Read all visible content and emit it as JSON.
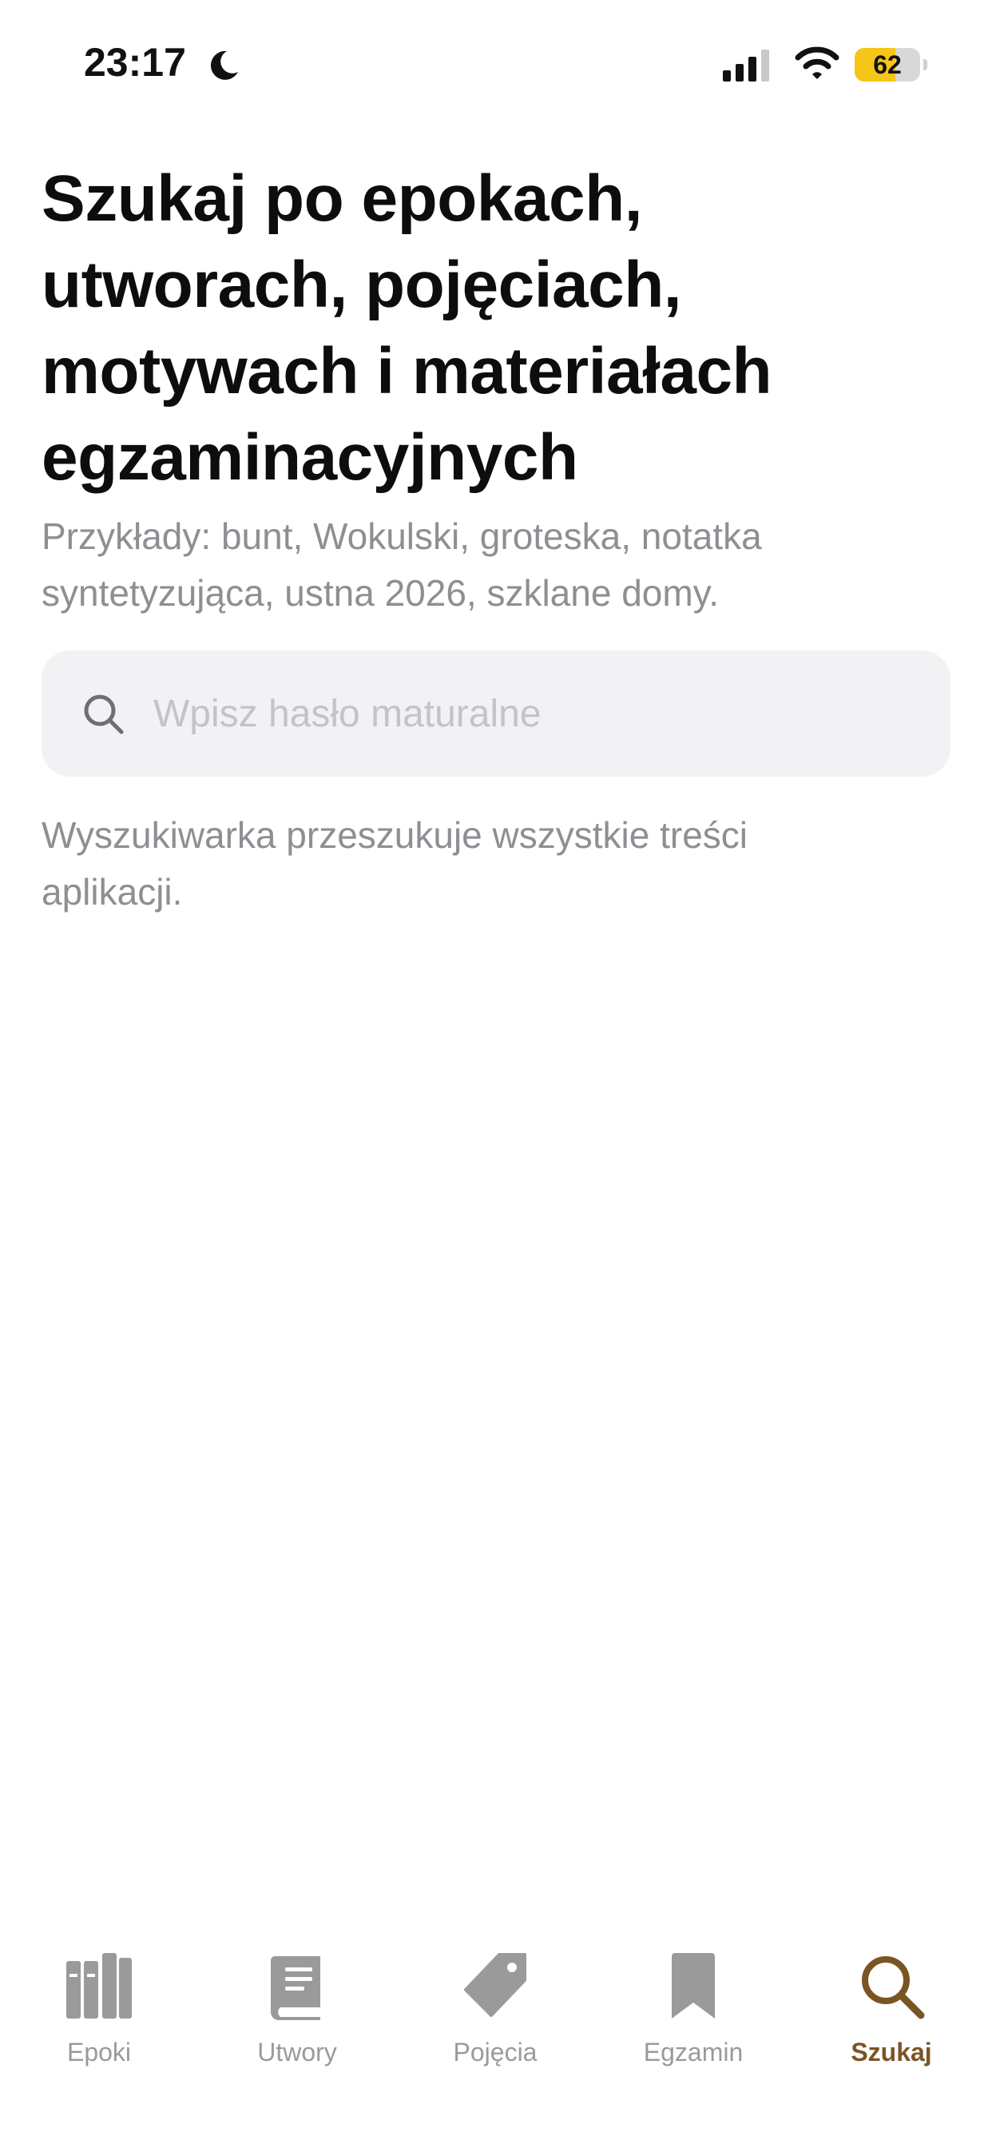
{
  "status_bar": {
    "time": "23:17",
    "battery_level": "62",
    "battery_fraction": 0.62,
    "battery_color": "#f5c518",
    "icons": [
      "moon-icon",
      "signal-icon",
      "wifi-icon",
      "battery-icon"
    ]
  },
  "header": {
    "title": "Szukaj po epokach, utworach, pojęciach, motywach i materiałach egzaminacyjnych",
    "subtitle": "Przykłady: bunt, Wokulski, groteska, notatka syntetyzująca, ustna 2026, szklane domy."
  },
  "search": {
    "placeholder": "Wpisz hasło maturalne",
    "value": "",
    "hint": "Wyszukiwarka przeszukuje wszystkie treści aplikacji."
  },
  "tab_bar": {
    "accent_color": "#7a5524",
    "inactive_color": "#9a9a9a",
    "tabs": [
      {
        "label": "Epoki",
        "icon": "books-icon",
        "active": false
      },
      {
        "label": "Utwory",
        "icon": "book-icon",
        "active": false
      },
      {
        "label": "Pojęcia",
        "icon": "tag-icon",
        "active": false
      },
      {
        "label": "Egzamin",
        "icon": "bookmark-icon",
        "active": false
      },
      {
        "label": "Szukaj",
        "icon": "search-icon",
        "active": true
      }
    ]
  }
}
